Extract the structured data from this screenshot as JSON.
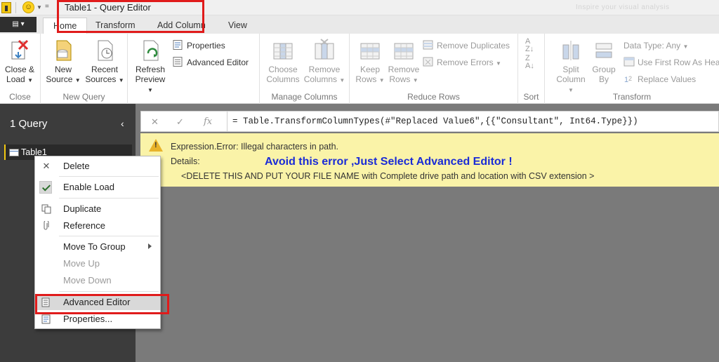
{
  "window": {
    "title": "Table1 - Query Editor",
    "faded_text": "Inspire your visual analysis"
  },
  "tabs": [
    {
      "label": "Home",
      "active": true
    },
    {
      "label": "Transform",
      "active": false
    },
    {
      "label": "Add Column",
      "active": false
    },
    {
      "label": "View",
      "active": false
    }
  ],
  "ribbon": {
    "close": {
      "button": "Close & Load",
      "line1": "Close &",
      "line2": "Load",
      "group": "Close"
    },
    "new_query": {
      "new_source": [
        "New",
        "Source"
      ],
      "recent_sources": [
        "Recent",
        "Sources"
      ],
      "group": "New Query"
    },
    "query": {
      "refresh": [
        "Refresh",
        "Preview"
      ],
      "properties": "Properties",
      "advanced_editor": "Advanced Editor"
    },
    "manage_columns": {
      "choose": [
        "Choose",
        "Columns"
      ],
      "remove": [
        "Remove",
        "Columns"
      ],
      "group": "Manage Columns"
    },
    "reduce_rows": {
      "keep": [
        "Keep",
        "Rows"
      ],
      "remove": [
        "Remove",
        "Rows"
      ],
      "remove_duplicates": "Remove Duplicates",
      "remove_errors": "Remove Errors",
      "group": "Reduce Rows"
    },
    "sort": {
      "group": "Sort"
    },
    "transform": {
      "split": [
        "Split",
        "Column"
      ],
      "group_by": [
        "Group",
        "By"
      ],
      "data_type": "Data Type: Any",
      "first_row": "Use First Row As Hea",
      "replace": "Replace Values",
      "group": "Transform"
    }
  },
  "queries": {
    "header": "1 Query",
    "items": [
      "Table1"
    ]
  },
  "formula": {
    "text": "= Table.TransformColumnTypes(#\"Replaced Value6\",{{\"Consultant\", Int64.Type}})"
  },
  "error": {
    "message": "Expression.Error: Illegal characters in path.",
    "details_label": "Details:",
    "detail_text": "<DELETE THIS AND PUT YOUR FILE NAME with Complete drive path and location with CSV extension >",
    "annotation": "Avoid this error ,Just Select Advanced Editor !"
  },
  "context_menu": {
    "delete": "Delete",
    "enable_load": "Enable Load",
    "duplicate": "Duplicate",
    "reference": "Reference",
    "move_to_group": "Move To Group",
    "move_up": "Move Up",
    "move_down": "Move Down",
    "advanced_editor": "Advanced Editor",
    "properties": "Properties..."
  },
  "colors": {
    "accent": "#f2c811",
    "highlight": "#e01b1b",
    "annotation": "#1a2bd6",
    "error_bg": "#faf3a8"
  }
}
